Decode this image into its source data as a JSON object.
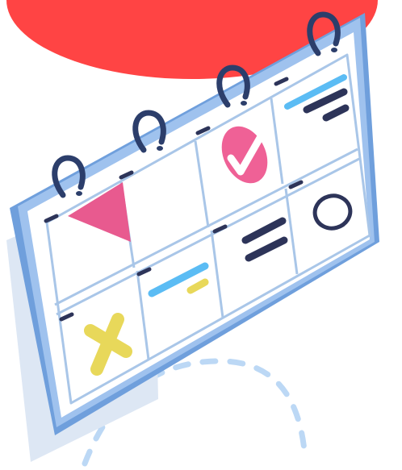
{
  "illustration": {
    "subject": "calendar-planner",
    "colors": {
      "background": "#ffffff",
      "blob": "#ff4444",
      "shadow": "#dde7f4",
      "frame_outer": "#6f9fdc",
      "frame_inner": "#9fc2ee",
      "paper": "#ffffff",
      "grid": "#a9c6e8",
      "ring": "#2c3e6b",
      "ring_highlight": "#3d5691",
      "bar_dark": "#2d3459",
      "bar_blue": "#5bbcf4",
      "bar_yellow": "#e8d85a",
      "pink": "#e85a8f",
      "check_circle": "#ef6196",
      "cross": "#e8d85a",
      "dashes": "#bcd8f5"
    },
    "icons": [
      "check-icon",
      "cross-icon",
      "circle-icon",
      "triangle-icon",
      "spiral-ring-icon"
    ]
  }
}
